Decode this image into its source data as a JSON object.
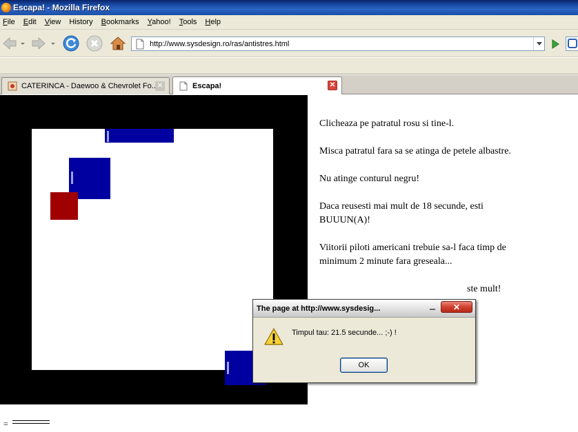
{
  "window": {
    "title": "Escapa! - Mozilla Firefox"
  },
  "menu": {
    "items": [
      {
        "label": "File",
        "accel": "F",
        "rest": "ile"
      },
      {
        "label": "Edit",
        "accel": "E",
        "rest": "dit"
      },
      {
        "label": "View",
        "accel": "V",
        "rest": "iew"
      },
      {
        "label": "History",
        "accel": "",
        "rest": "History"
      },
      {
        "label": "Bookmarks",
        "accel": "B",
        "rest": "ookmarks"
      },
      {
        "label": "Yahoo!",
        "accel": "Y",
        "rest": "ahoo!"
      },
      {
        "label": "Tools",
        "accel": "T",
        "rest": "ools"
      },
      {
        "label": "Help",
        "accel": "H",
        "rest": "elp"
      }
    ]
  },
  "navbar": {
    "url": "http://www.sysdesign.ro/ras/antistres.html"
  },
  "tabs": [
    {
      "label": "CATERINCA - Daewoo & Chevrolet Fo...",
      "active": false
    },
    {
      "label": "Escapa!",
      "active": true
    }
  ],
  "instructions": {
    "p1": "Clicheaza pe patratul rosu si tine-l.",
    "p2": "Misca patratul fara sa se atinga de petele albastre.",
    "p3": "Nu atinge conturul negru!",
    "p4": "Daca reusesti mai mult de 18 secunde, esti BUUUN(A)!",
    "p5": "Viitorii piloti americani trebuie sa-l faca timp de minimum 2 minute fara greseala...",
    "p6_visible": "ste mult!"
  },
  "footer": {
    "text": "="
  },
  "dialog": {
    "title": "The page at http://www.sysdesig...",
    "message": "Timpul tau: 21.5 secunde... ;-) !",
    "ok_label": "OK",
    "close_glyph": "✕"
  },
  "colors": {
    "blue_block": "#0000a0",
    "red_square": "#a00000",
    "frame": "#000000"
  }
}
